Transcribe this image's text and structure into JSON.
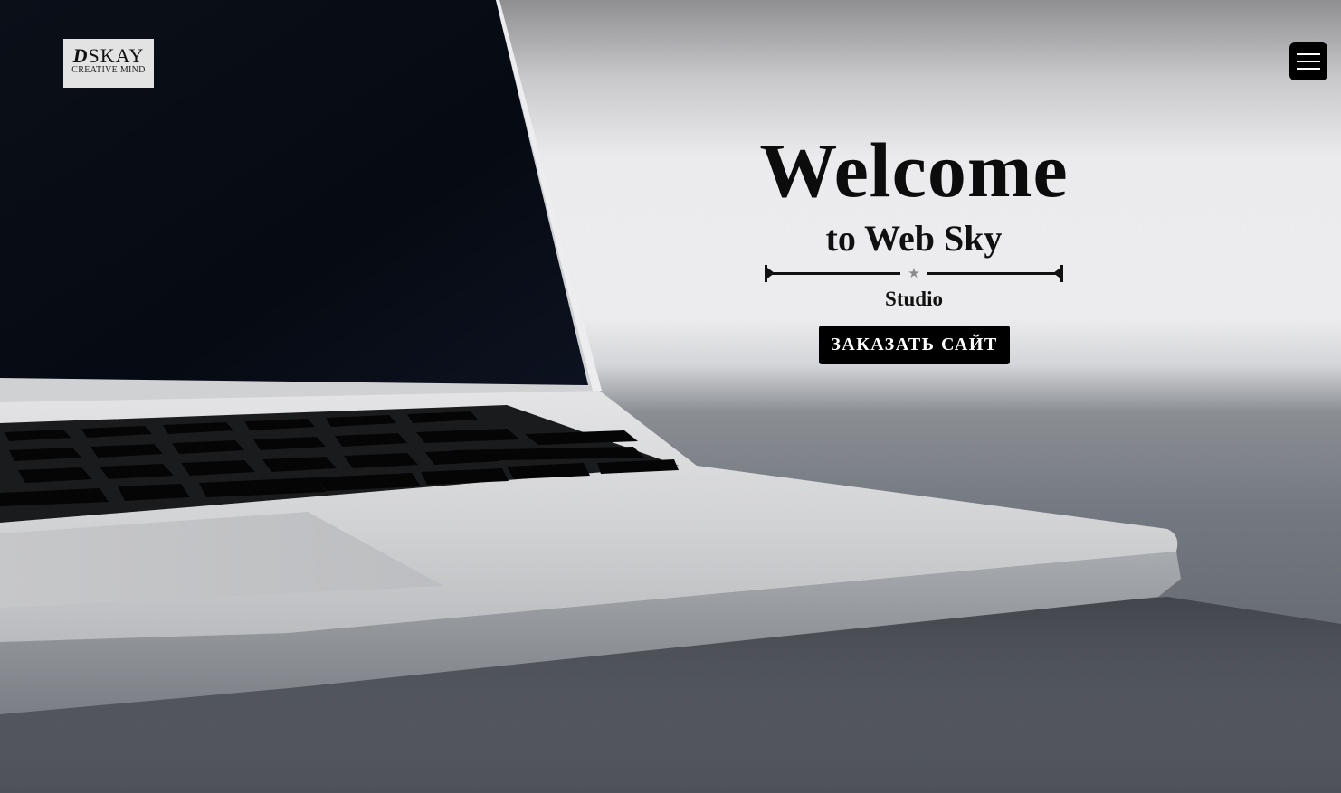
{
  "header": {
    "logo": {
      "main_letter": "D",
      "main_text": "SKAY",
      "tagline": "CREATIVE MIND"
    },
    "menu_button": {
      "icon": "hamburger-menu-icon"
    }
  },
  "hero": {
    "title": "Welcome",
    "subtitle": "to Web Sky",
    "divider_icon": "★",
    "label": "Studio",
    "cta_label": "ЗАКАЗАТЬ САЙТ"
  },
  "colors": {
    "accent": "#000000",
    "text": "#0c0c0c",
    "button_text": "#ffffff",
    "logo_background": "#e3e3e3"
  }
}
